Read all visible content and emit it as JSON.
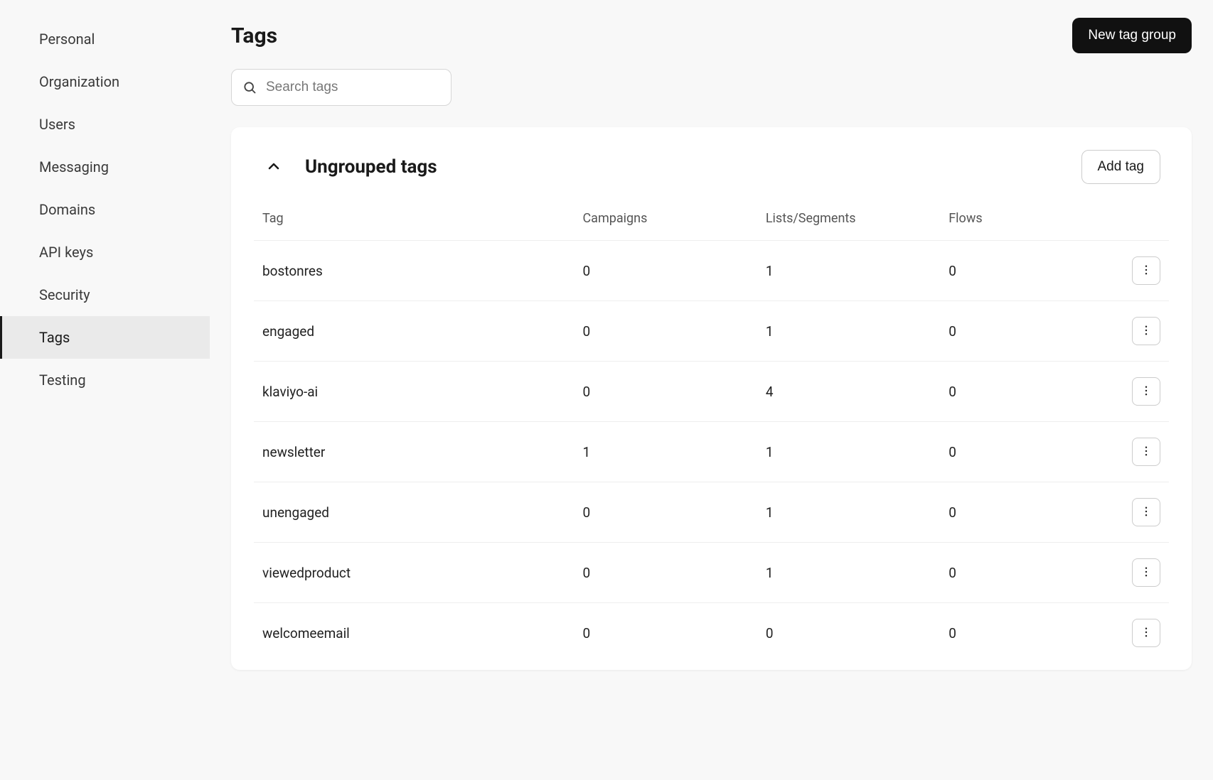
{
  "sidebar": {
    "items": [
      {
        "label": "Personal",
        "active": false
      },
      {
        "label": "Organization",
        "active": false
      },
      {
        "label": "Users",
        "active": false
      },
      {
        "label": "Messaging",
        "active": false
      },
      {
        "label": "Domains",
        "active": false
      },
      {
        "label": "API keys",
        "active": false
      },
      {
        "label": "Security",
        "active": false
      },
      {
        "label": "Tags",
        "active": true
      },
      {
        "label": "Testing",
        "active": false
      }
    ]
  },
  "page": {
    "title": "Tags",
    "new_group_label": "New tag group"
  },
  "search": {
    "placeholder": "Search tags",
    "value": ""
  },
  "group": {
    "title": "Ungrouped tags",
    "add_label": "Add tag"
  },
  "table": {
    "headers": {
      "tag": "Tag",
      "campaigns": "Campaigns",
      "lists_segments": "Lists/Segments",
      "flows": "Flows"
    },
    "rows": [
      {
        "tag": "bostonres",
        "campaigns": "0",
        "lists_segments": "1",
        "flows": "0"
      },
      {
        "tag": "engaged",
        "campaigns": "0",
        "lists_segments": "1",
        "flows": "0"
      },
      {
        "tag": "klaviyo-ai",
        "campaigns": "0",
        "lists_segments": "4",
        "flows": "0"
      },
      {
        "tag": "newsletter",
        "campaigns": "1",
        "lists_segments": "1",
        "flows": "0"
      },
      {
        "tag": "unengaged",
        "campaigns": "0",
        "lists_segments": "1",
        "flows": "0"
      },
      {
        "tag": "viewedproduct",
        "campaigns": "0",
        "lists_segments": "1",
        "flows": "0"
      },
      {
        "tag": "welcomeemail",
        "campaigns": "0",
        "lists_segments": "0",
        "flows": "0"
      }
    ]
  }
}
